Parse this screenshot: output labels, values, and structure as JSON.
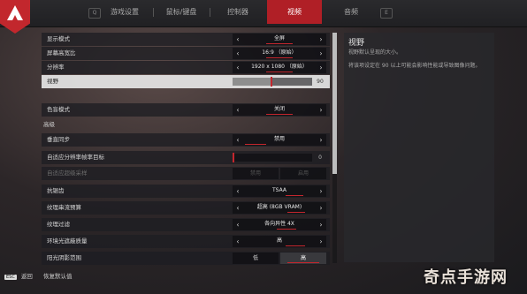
{
  "tabs": [
    "游戏设置",
    "鼠标/键盘",
    "控制器",
    "视频",
    "音频"
  ],
  "active_tab": "视频",
  "hints": {
    "left": "Q",
    "right": "E"
  },
  "rows": [
    {
      "label": "显示模式",
      "value": "全屏"
    },
    {
      "label": "屏幕高宽比",
      "value": "16:9 （原始）"
    },
    {
      "label": "分辨率",
      "value": "1920 x 1080 （原始）"
    },
    {
      "label": "视野",
      "value": "90",
      "fill_fraction": 0.48
    },
    {
      "label": "色盲模式",
      "value": "关闭"
    }
  ],
  "section_advanced": "高级",
  "adv_rows": [
    {
      "label": "垂直同步",
      "value": "禁用"
    },
    {
      "label": "自适应分辨率帧率目标",
      "value": "0"
    },
    {
      "label": "自适应超级采样",
      "value_a": "禁用",
      "value_b": "启用"
    },
    {
      "label": "抗锯齿",
      "value": "TSAA"
    },
    {
      "label": "纹理串流预算",
      "value": "超高 (8GB VRAM)"
    },
    {
      "label": "纹理过滤",
      "value": "各向异性 4X"
    },
    {
      "label": "环境光遮蔽质量",
      "value": "高"
    },
    {
      "label": "阳光阴影范围",
      "value_a": "低",
      "value_b": "高"
    }
  ],
  "info": {
    "title": "视野",
    "subtitle": "视野默认呈现的大小。",
    "body": "将该项设定在 90 以上可能会影响性能或导致图像问题。"
  },
  "footer": {
    "esc": "ESC",
    "back": "返回",
    "reset": "恢复默认值"
  },
  "watermark": "奇点手游网",
  "colors": {
    "accent": "#c4262d"
  }
}
